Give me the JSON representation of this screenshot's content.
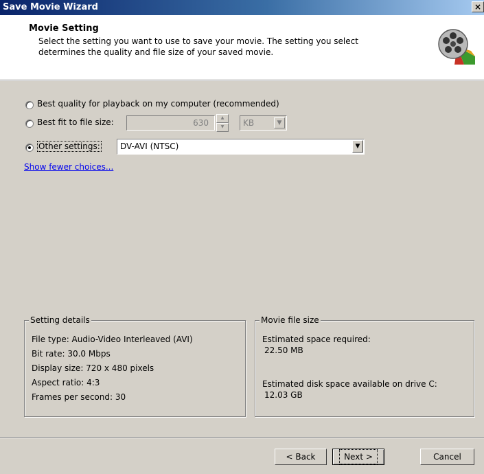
{
  "window": {
    "title": "Save Movie Wizard",
    "close_glyph": "×"
  },
  "header": {
    "title": "Movie Setting",
    "description_line1": "Select the setting you want to use to save your movie. The setting you select",
    "description_line2": "determines the quality and file size of your saved movie.",
    "icon": "film-reel-icon"
  },
  "options": {
    "best_quality": {
      "label": "Best quality for playback on my computer (recommended)",
      "selected": false
    },
    "best_fit": {
      "label": "Best fit to file size:",
      "size_value": "630",
      "unit": "KB",
      "selected": false
    },
    "other": {
      "label": "Other settings:",
      "value": "DV-AVI (NTSC)",
      "selected": true
    }
  },
  "show_fewer_link": "Show fewer choices...",
  "setting_details": {
    "title": "Setting details",
    "file_type": "File type: Audio-Video Interleaved (AVI)",
    "bit_rate": "Bit rate: 30.0 Mbps",
    "display_size": "Display size: 720 x 480 pixels",
    "aspect_ratio": "Aspect ratio: 4:3",
    "fps": "Frames per second: 30"
  },
  "movie_file_size": {
    "title": "Movie file size",
    "estimated_label": "Estimated space required:",
    "estimated_value": "22.50 MB",
    "disk_label": "Estimated disk space available on drive C:",
    "disk_value": "12.03 GB"
  },
  "buttons": {
    "back": "< Back",
    "next": "Next >",
    "cancel": "Cancel"
  },
  "colors": {
    "dialog_bg": "#d4d0c8",
    "title_start": "#0a246a",
    "title_end": "#a6caf0",
    "link": "#0000ee"
  }
}
